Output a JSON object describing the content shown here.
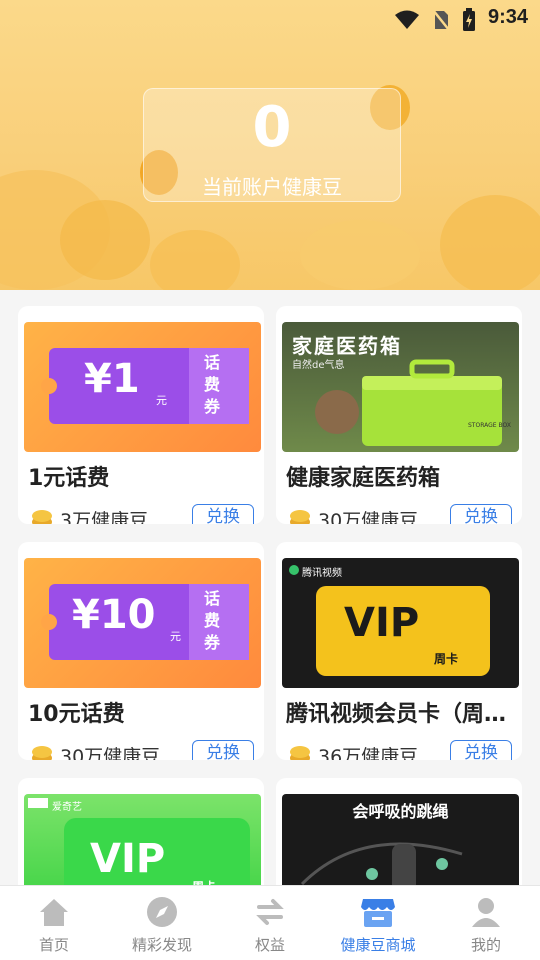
{
  "status_bar": {
    "time": "9:34"
  },
  "account": {
    "balance": "0",
    "label": "当前账户健康豆"
  },
  "products": [
    {
      "title": "1元话费",
      "price": "3万健康豆",
      "action": "兑换",
      "thumb": {
        "amount": "¥1",
        "unit": "元",
        "tag": "话费券"
      }
    },
    {
      "title": "健康家庭医药箱",
      "price": "30万健康豆",
      "action": "兑换",
      "thumb": {
        "heading": "家庭医药箱",
        "sub": "自然de气息",
        "box_label": "STORAGE BOX"
      }
    },
    {
      "title": "10元话费",
      "price": "30万健康豆",
      "action": "兑换",
      "thumb": {
        "amount": "¥10",
        "unit": "元",
        "tag": "话费券"
      }
    },
    {
      "title": "腾讯视频会员卡（周卡）",
      "price": "36万健康豆",
      "action": "兑换",
      "thumb": {
        "brand": "腾讯视频",
        "vip": "VIP",
        "period": "周卡"
      }
    },
    {
      "title": "",
      "price": "",
      "action": "",
      "thumb": {
        "brand": "爱奇艺",
        "vip": "VIP",
        "period": "周卡"
      }
    },
    {
      "title": "",
      "price": "",
      "action": "",
      "thumb": {
        "heading": "会呼吸的跳绳"
      }
    }
  ],
  "nav": [
    {
      "label": "首页",
      "icon": "home-icon"
    },
    {
      "label": "精彩发现",
      "icon": "compass-icon"
    },
    {
      "label": "权益",
      "icon": "exchange-icon"
    },
    {
      "label": "健康豆商城",
      "icon": "store-icon",
      "active": true
    },
    {
      "label": "我的",
      "icon": "user-icon"
    }
  ],
  "colors": {
    "accent": "#3a7fe6",
    "header": "#f9cf7a",
    "voucher_purple": "#8b3fe0",
    "iqiyi_green": "#3fd13f"
  }
}
